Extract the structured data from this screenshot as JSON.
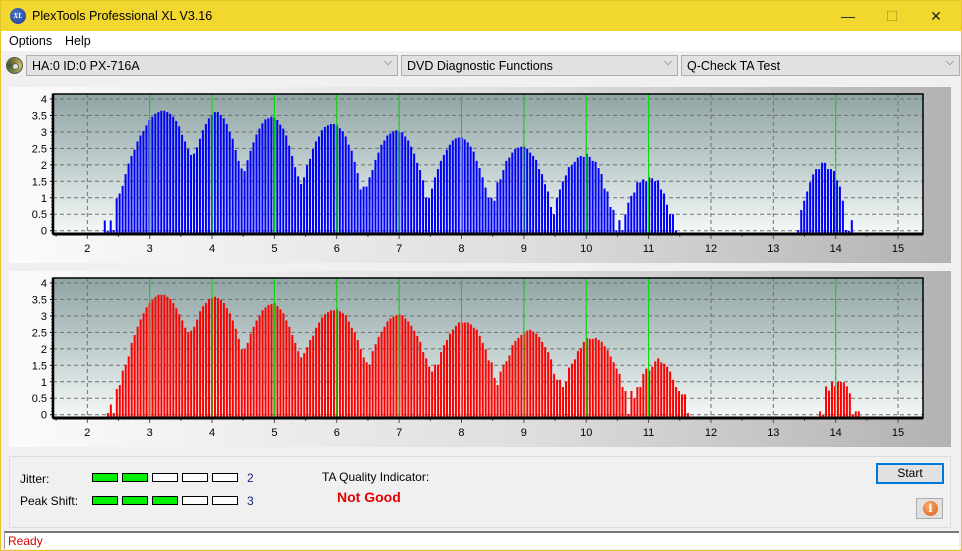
{
  "window": {
    "title": "PlexTools Professional XL V3.16",
    "app_icon_text": "XL",
    "controls": {
      "minimize": "—",
      "maximize": "☐",
      "close": "✕"
    }
  },
  "menu": {
    "items": [
      "Options",
      "Help"
    ]
  },
  "toolbar": {
    "drive": "HA:0 ID:0  PX-716A",
    "function_group": "DVD Diagnostic Functions",
    "test": "Q-Check TA Test",
    "chevron": "⌵"
  },
  "colors": {
    "top_series": "#0000ff",
    "bottom_series": "#ff0000",
    "marker_lines": "#00e000",
    "meter_on": "#00f000",
    "quality_text": "#e50000",
    "status_text": "#e00000"
  },
  "chart_data": [
    {
      "type": "bar",
      "title": "",
      "xlabel": "",
      "ylabel": "",
      "xlim": [
        1.45,
        15.4
      ],
      "ylim": [
        -0.1,
        4.15
      ],
      "xticks": [
        "2",
        "3",
        "4",
        "5",
        "6",
        "7",
        "8",
        "9",
        "10",
        "11",
        "12",
        "13",
        "14",
        "15"
      ],
      "yticks": [
        "0",
        "0.5",
        "1",
        "1.5",
        "2",
        "2.5",
        "3",
        "3.5",
        "4"
      ],
      "grid": true,
      "marker_lines_x": [
        3,
        4,
        5,
        6,
        7,
        8,
        9,
        10,
        11,
        14
      ],
      "series": [
        {
          "name": "blue",
          "segments": [
            {
              "start": 2.28,
              "step": 0.0477,
              "values": [
                0.31,
                0,
                0.31,
                0.02,
                0.98,
                1.13,
                1.36,
                1.72,
                2.04,
                2.27,
                2.46,
                2.71,
                2.89,
                3.03,
                3.2,
                3.36,
                3.46,
                3.55,
                3.6,
                3.64,
                3.64,
                3.6,
                3.55,
                3.46,
                3.33,
                3.17,
                2.91,
                2.71,
                2.48,
                2.3,
                2.34,
                2.53,
                2.79,
                3.05,
                3.24,
                3.41,
                3.51,
                3.6,
                3.6,
                3.51,
                3.41,
                3.24,
                3.0,
                2.79,
                2.45,
                2.12,
                1.89,
                1.81,
                2.14,
                2.43,
                2.68,
                2.92,
                3.1,
                3.26,
                3.38,
                3.41,
                3.46,
                3.43,
                3.36,
                3.22,
                3.1,
                2.89,
                2.58,
                2.27,
                1.93,
                1.65,
                1.42,
                1.62,
                1.99,
                2.18,
                2.48,
                2.71,
                2.86,
                3.05,
                3.15,
                3.2,
                3.24,
                3.24,
                3.2,
                3.11,
                3.02,
                2.86,
                2.61,
                2.43,
                2.09,
                1.75,
                1.25,
                1.34,
                1.34,
                1.62,
                1.84,
                2.15,
                2.37,
                2.61,
                2.74,
                2.89,
                2.95,
                3.02,
                3.05,
                2.99,
                2.99,
                2.86,
                2.74,
                2.55,
                2.34,
                2.06,
                1.84,
                1.53,
                1.0,
                1.0,
                1.28,
                1.62,
                1.87,
                2.12,
                2.3,
                2.46,
                2.61,
                2.74,
                2.8,
                2.83,
                2.83,
                2.77,
                2.68,
                2.55,
                2.4,
                2.12,
                1.9,
                1.62,
                1.31,
                1.0,
                1.0,
                0.91,
                1.47,
                1.56,
                1.84,
                2.12,
                2.22,
                2.37,
                2.49,
                2.52,
                2.55,
                2.55,
                2.49,
                2.37,
                2.27,
                2.15,
                1.87,
                1.72,
                1.41,
                1.19,
                0.72,
                0.5,
                1.0,
                1.25,
                1.5,
                1.68,
                1.93,
                1.99,
                2.09,
                2.22,
                2.27,
                2.24,
                2.34,
                2.24,
                2.12,
                2.09,
                1.9,
                1.72,
                1.28,
                1.19,
                0.72,
                0.63,
                0.01,
                0.32,
                0.01,
                0.5,
                0.85,
                1.06,
                1.16,
                1.47,
                1.47,
                1.56,
                1.5,
                1.62,
                1.59,
                1.5,
                1.53,
                1.25,
                1.13,
                0.79,
                0.5,
                0.5,
                0.01
              ]
            },
            {
              "start": 13.4,
              "step": 0.0477,
              "values": [
                0.02,
                0.63,
                0.91,
                1.19,
                1.47,
                1.71,
                1.87,
                1.87,
                2.06,
                2.06,
                1.87,
                1.87,
                1.81,
                1.53,
                1.34,
                0.91,
                0.02,
                0,
                0.32
              ]
            }
          ]
        }
      ]
    },
    {
      "type": "bar",
      "title": "",
      "xlabel": "",
      "ylabel": "",
      "xlim": [
        1.45,
        15.4
      ],
      "ylim": [
        -0.1,
        4.15
      ],
      "xticks": [
        "2",
        "3",
        "4",
        "5",
        "6",
        "7",
        "8",
        "9",
        "10",
        "11",
        "12",
        "13",
        "14",
        "15"
      ],
      "yticks": [
        "0",
        "0.5",
        "1",
        "1.5",
        "2",
        "2.5",
        "3",
        "3.5",
        "4"
      ],
      "grid": true,
      "marker_lines_x": [
        3,
        4,
        5,
        6,
        7,
        8,
        9,
        10,
        11,
        14
      ],
      "series": [
        {
          "name": "red",
          "segments": [
            {
              "start": 2.33,
              "step": 0.0477,
              "values": [
                0.05,
                0.31,
                0.05,
                0.78,
                0.9,
                1.34,
                1.52,
                1.77,
                2.18,
                2.42,
                2.67,
                2.89,
                3.08,
                3.26,
                3.39,
                3.48,
                3.58,
                3.64,
                3.64,
                3.64,
                3.58,
                3.51,
                3.39,
                3.23,
                3.05,
                2.86,
                2.64,
                2.49,
                2.55,
                2.67,
                2.89,
                3.14,
                3.3,
                3.39,
                3.51,
                3.54,
                3.58,
                3.54,
                3.48,
                3.39,
                3.23,
                3.08,
                2.86,
                2.61,
                2.3,
                1.99,
                1.99,
                2.18,
                2.46,
                2.67,
                2.86,
                3.02,
                3.17,
                3.26,
                3.33,
                3.36,
                3.39,
                3.3,
                3.2,
                3.08,
                2.86,
                2.67,
                2.42,
                2.18,
                1.93,
                1.74,
                1.87,
                2.05,
                2.27,
                2.4,
                2.64,
                2.8,
                2.95,
                3.05,
                3.11,
                3.17,
                3.17,
                3.2,
                3.14,
                3.08,
                3.02,
                2.83,
                2.64,
                2.49,
                2.27,
                1.99,
                1.74,
                1.59,
                1.52,
                1.93,
                2.14,
                2.36,
                2.52,
                2.67,
                2.83,
                2.92,
                2.98,
                3.02,
                3.05,
                3.02,
                2.92,
                2.83,
                2.7,
                2.55,
                2.39,
                2.21,
                1.9,
                1.71,
                1.46,
                1.31,
                1.52,
                1.52,
                1.9,
                2.11,
                2.27,
                2.46,
                2.58,
                2.7,
                2.8,
                2.8,
                2.8,
                2.8,
                2.74,
                2.64,
                2.58,
                2.39,
                2.18,
                1.99,
                1.65,
                1.59,
                1.12,
                0.9,
                1.31,
                1.52,
                1.62,
                1.8,
                2.11,
                2.24,
                2.33,
                2.42,
                2.46,
                2.55,
                2.58,
                2.52,
                2.46,
                2.36,
                2.21,
                2.05,
                1.9,
                1.68,
                1.24,
                1.06,
                1.06,
                0.84,
                1.0,
                1.43,
                1.55,
                1.68,
                1.93,
                2.02,
                2.21,
                2.33,
                2.3,
                2.3,
                2.33,
                2.27,
                2.21,
                2.08,
                1.96,
                1.77,
                1.59,
                1.4,
                1.24,
                0.84,
                0.72,
                0.02,
                0.72,
                0.5,
                0.84,
                0.84,
                1.24,
                1.4,
                1.34,
                1.46,
                1.62,
                1.71,
                1.59,
                1.55,
                1.46,
                1.31,
                1.06,
                0.84,
                0.72,
                0.62,
                0.62,
                0.05
              ]
            },
            {
              "start": 13.75,
              "step": 0.0477,
              "values": [
                0.1,
                0,
                0.86,
                0.73,
                1.0,
                0.86,
                1.0,
                1.0,
                0.98,
                0.86,
                0.65,
                0,
                0.1,
                0.1
              ]
            }
          ]
        }
      ]
    }
  ],
  "results": {
    "jitter": {
      "label": "Jitter:",
      "value": "2",
      "level": 2,
      "max": 5
    },
    "peak_shift": {
      "label": "Peak Shift:",
      "value": "3",
      "level": 3,
      "max": 5
    },
    "ta_quality_label": "TA Quality Indicator:",
    "ta_quality_value": "Not Good"
  },
  "buttons": {
    "start": "Start",
    "info": "i"
  },
  "status": {
    "text": "Ready"
  }
}
